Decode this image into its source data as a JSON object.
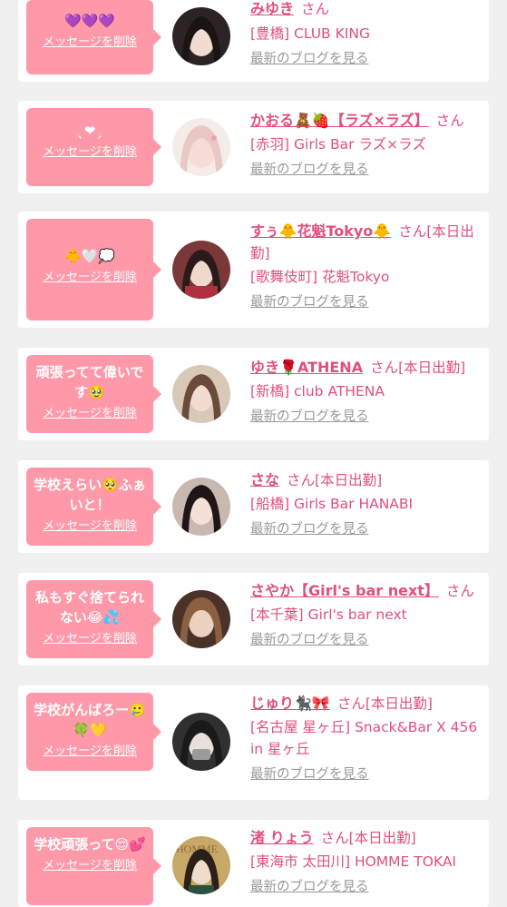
{
  "ui": {
    "delete_label": "メッセージを削除",
    "blog_label": "最新のブログを見る",
    "san": "さん"
  },
  "cards": [
    {
      "message": "💜💜💜",
      "name": "みゆき",
      "status": "",
      "shop": "[豊橋] CLUB KING",
      "avatar_color": "#2c2424"
    },
    {
      "message": "ˎ❤ˏ",
      "name": "かおる🧸🍓【ラズ×ラズ】",
      "status": "",
      "shop": "[赤羽] Girls Bar ラズ×ラズ",
      "avatar_color": "#e8c8c4"
    },
    {
      "message": "🐥🤍💭",
      "name": "すぅ🐥花魁Tokyo🐥",
      "status": "[本日出勤]",
      "shop": "[歌舞伎町] 花魁Tokyo",
      "avatar_color": "#5a2a2a"
    },
    {
      "message": "頑張ってて偉いです🥹",
      "name": "ゆき🌹ATHENA",
      "status": "[本日出勤]",
      "shop": "[新橋] club ATHENA",
      "avatar_color": "#b89878"
    },
    {
      "message": "学校えらい🥺ふぁいと！",
      "name": "さな",
      "status": "[本日出勤]",
      "shop": "[船橋] Girls Bar HANABI",
      "avatar_color": "#3a2a2a"
    },
    {
      "message": "私もすぐ捨てられない😂💦",
      "name": "さやか【Girl's bar next】",
      "status": "",
      "shop": "[本千葉] Girl's bar next",
      "avatar_color": "#6a4a3a"
    },
    {
      "message": "学校がんばろー🥲🍀💛",
      "name": "じゅり🐈‍⬛🎀",
      "status": "[本日出勤]",
      "shop": "[名古屋 星ヶ丘] Snack&Bar X 456 in 星ヶ丘",
      "avatar_color": "#2a2a2a"
    },
    {
      "message": "学校頑張って😌💕",
      "name": "渚 りょう",
      "status": "[本日出勤]",
      "shop": "[東海市 太田川] HOMME TOKAI",
      "avatar_color": "#c8a868"
    }
  ]
}
